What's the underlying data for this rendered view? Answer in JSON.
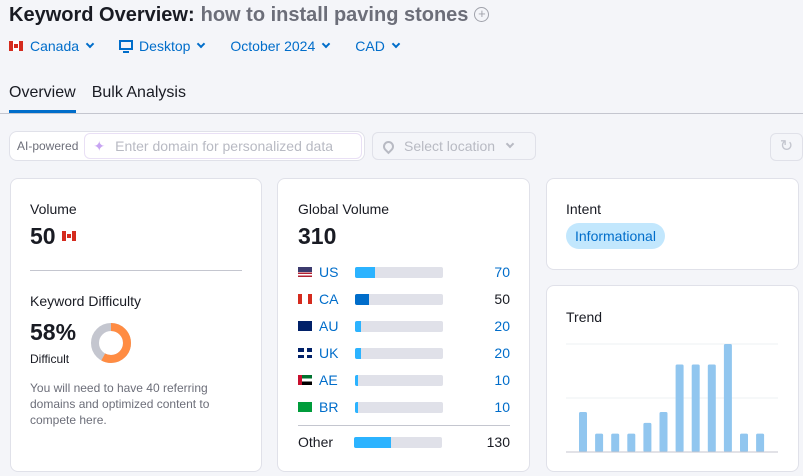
{
  "header": {
    "title": "Keyword Overview:",
    "keyword": "how to install paving stones",
    "add_icon": "plus-circle-icon"
  },
  "filters": [
    {
      "label": "Canada",
      "icon": "canada-flag-icon"
    },
    {
      "label": "Desktop",
      "icon": "desktop-icon"
    },
    {
      "label": "October 2024"
    },
    {
      "label": "CAD"
    }
  ],
  "tabs": [
    {
      "label": "Overview",
      "active": true
    },
    {
      "label": "Bulk Analysis"
    }
  ],
  "ai": {
    "label": "AI-powered",
    "placeholder": "Enter domain for personalized data"
  },
  "location": {
    "placeholder": "Select location"
  },
  "volume": {
    "label": "Volume",
    "value": "50"
  },
  "difficulty": {
    "label": "Keyword Difficulty",
    "value": "58%",
    "level": "Difficult",
    "percent": 58,
    "description": "You will need to have 40 referring domains and optimized content to compete here."
  },
  "global": {
    "label": "Global Volume",
    "value": "310",
    "countries": [
      {
        "code": "US",
        "value": "70",
        "num": 70,
        "color": "#2bb3ff"
      },
      {
        "code": "CA",
        "value": "50",
        "num": 50,
        "color": "#006dca"
      },
      {
        "code": "AU",
        "value": "20",
        "num": 20,
        "color": "#2bb3ff"
      },
      {
        "code": "UK",
        "value": "20",
        "num": 20,
        "color": "#2bb3ff"
      },
      {
        "code": "AE",
        "value": "10",
        "num": 10,
        "color": "#2bb3ff"
      },
      {
        "code": "BR",
        "value": "10",
        "num": 10,
        "color": "#2bb3ff"
      }
    ],
    "other": {
      "label": "Other",
      "value": "130",
      "num": 130
    }
  },
  "intent": {
    "label": "Intent",
    "value": "Informational"
  },
  "trend": {
    "label": "Trend",
    "relative_values": [
      0.37,
      0.17,
      0.17,
      0.17,
      0.27,
      0.37,
      0.81,
      0.81,
      0.81,
      1.0,
      0.17,
      0.17
    ],
    "color": "#91c6ef"
  }
}
